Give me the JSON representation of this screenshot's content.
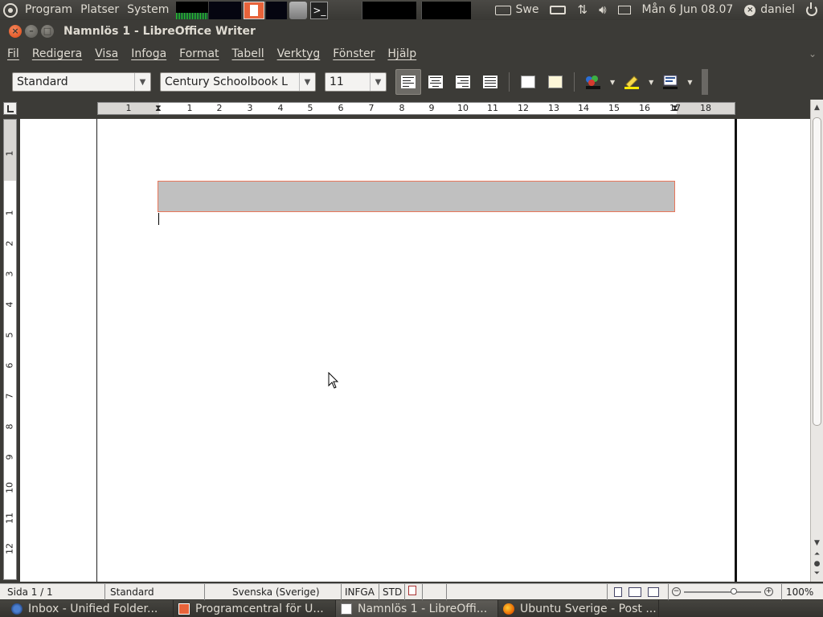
{
  "top_panel": {
    "menus": [
      "Program",
      "Platser",
      "System"
    ],
    "keyboard_layout": "Swe",
    "clock": "Mån  6 Jun 08.07",
    "user": "daniel"
  },
  "window": {
    "title": "Namnlös 1 - LibreOffice Writer"
  },
  "menubar": {
    "items": [
      "Fil",
      "Redigera",
      "Visa",
      "Infoga",
      "Format",
      "Tabell",
      "Verktyg",
      "Fönster",
      "Hjälp"
    ]
  },
  "toolbar": {
    "paragraph_style": "Standard",
    "font_name": "Century Schoolbook L",
    "font_size": "11",
    "active_alignment": "align-left"
  },
  "ruler": {
    "horizontal_labels": [
      "1",
      "1",
      "2",
      "3",
      "4",
      "5",
      "6",
      "7",
      "8",
      "9",
      "10",
      "11",
      "12",
      "13",
      "14",
      "15",
      "16",
      "17",
      "18"
    ],
    "vertical_labels": [
      "1",
      "1",
      "2",
      "3",
      "4",
      "5",
      "6",
      "7",
      "8",
      "9",
      "10",
      "11",
      "12"
    ]
  },
  "statusbar": {
    "page": "Sida  1 / 1",
    "page_style": "Standard",
    "language": "Svenska (Sverige)",
    "insert_mode": "INFGA",
    "selection_mode": "STD",
    "zoom": "100%"
  },
  "taskbar": {
    "tasks": [
      {
        "label": "Inbox - Unified Folder...",
        "icon": "mail-icon"
      },
      {
        "label": "Programcentral för U...",
        "icon": "software-center-icon"
      },
      {
        "label": "Namnlös 1 - LibreOffi...",
        "icon": "writer-doc-icon"
      },
      {
        "label": "Ubuntu Sverige - Post ...",
        "icon": "firefox-icon"
      }
    ]
  },
  "colors": {
    "panel_bg": "#3c3b37",
    "close_button": "#dd4814",
    "header_field": "#c0c0c0",
    "header_field_border": "#e8765a"
  }
}
